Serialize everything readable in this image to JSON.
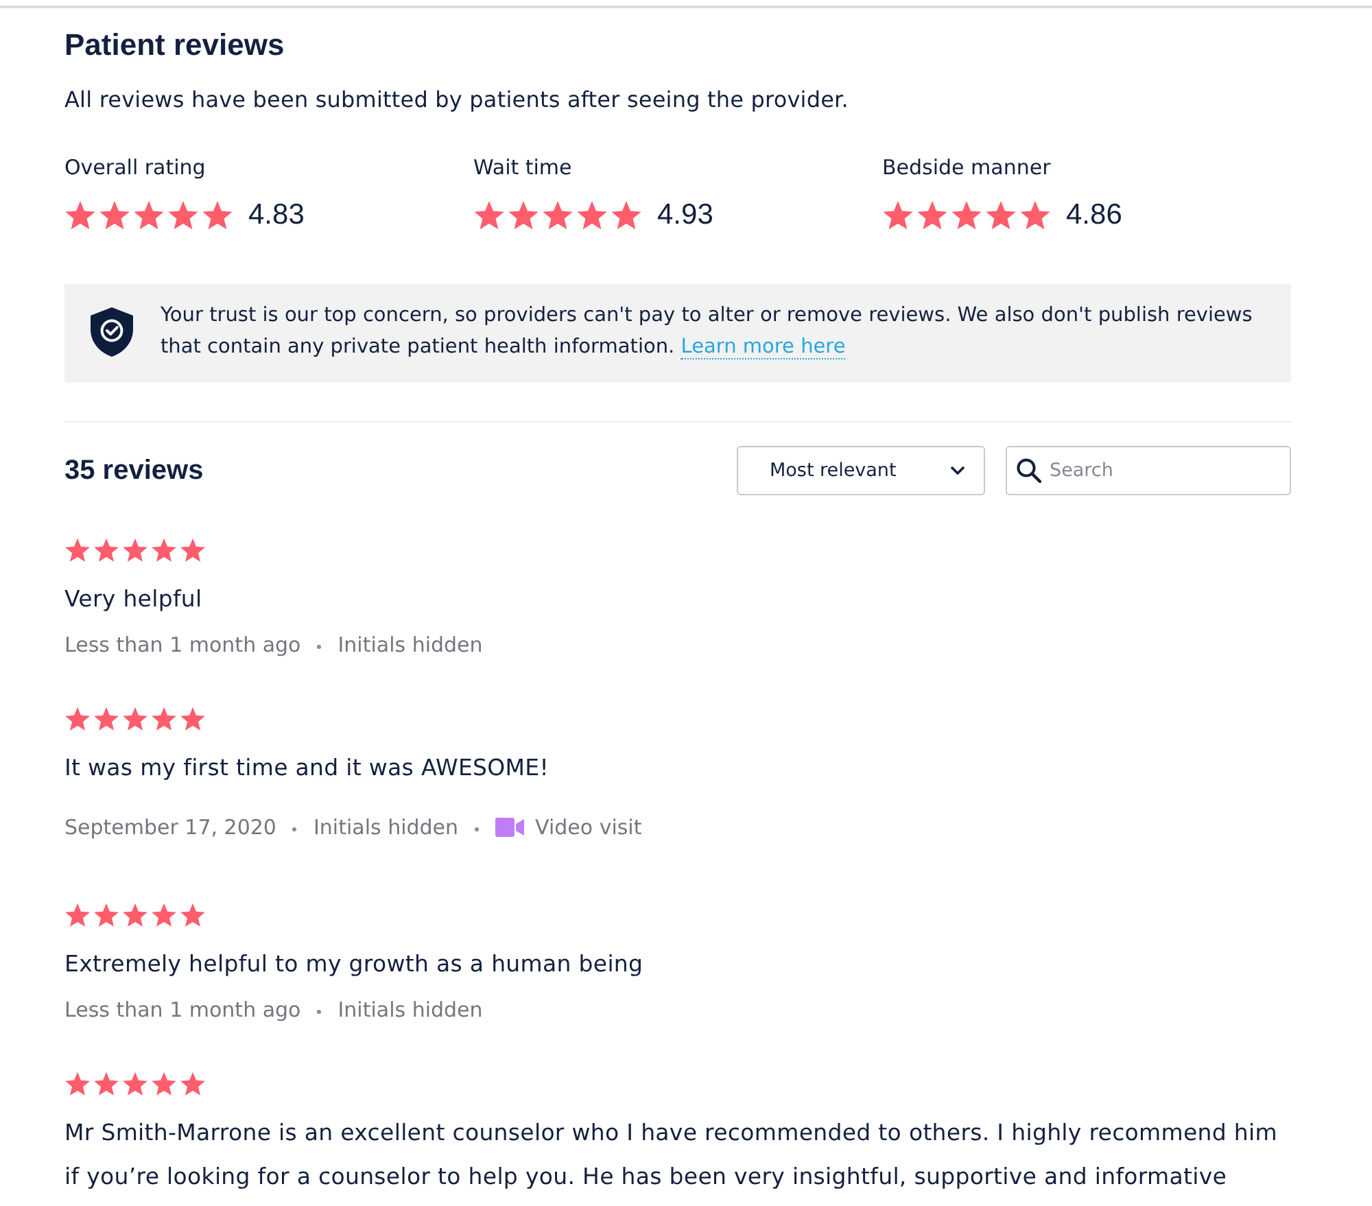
{
  "header": {
    "title": "Patient reviews",
    "subtitle": "All reviews have been submitted by patients after seeing the provider."
  },
  "ratings": [
    {
      "label": "Overall rating",
      "stars": 5,
      "value": "4.83"
    },
    {
      "label": "Wait time",
      "stars": 5,
      "value": "4.93"
    },
    {
      "label": "Bedside manner",
      "stars": 5,
      "value": "4.86"
    }
  ],
  "notice": {
    "text": "Your trust is our top concern, so providers can't pay to alter or remove reviews. We also don't publish reviews that contain any private patient health information.",
    "link": "Learn more here"
  },
  "toolbar": {
    "count": "35 reviews",
    "sort": "Most relevant",
    "search": {
      "placeholder": "Search"
    }
  },
  "reviews": [
    {
      "stars": 5,
      "text": "Very helpful",
      "meta": [
        {
          "kind": "text",
          "text": "Less than 1 month ago"
        },
        {
          "kind": "text",
          "text": "Initials hidden"
        }
      ]
    },
    {
      "stars": 5,
      "text": "It was my first time and it was AWESOME!",
      "meta": [
        {
          "kind": "text",
          "text": "September 17, 2020"
        },
        {
          "kind": "text",
          "text": "Initials hidden"
        },
        {
          "kind": "video",
          "text": "Video visit"
        }
      ]
    },
    {
      "stars": 5,
      "text": "Extremely helpful to my growth as a human being",
      "meta": [
        {
          "kind": "text",
          "text": "Less than 1 month ago"
        },
        {
          "kind": "text",
          "text": "Initials hidden"
        }
      ]
    },
    {
      "stars": 5,
      "text": "Mr Smith-Marrone is an excellent counselor who I have recommended to others. I highly recommend him if you’re looking for a counselor to help you. He has been very insightful, supportive and informative"
    }
  ]
}
